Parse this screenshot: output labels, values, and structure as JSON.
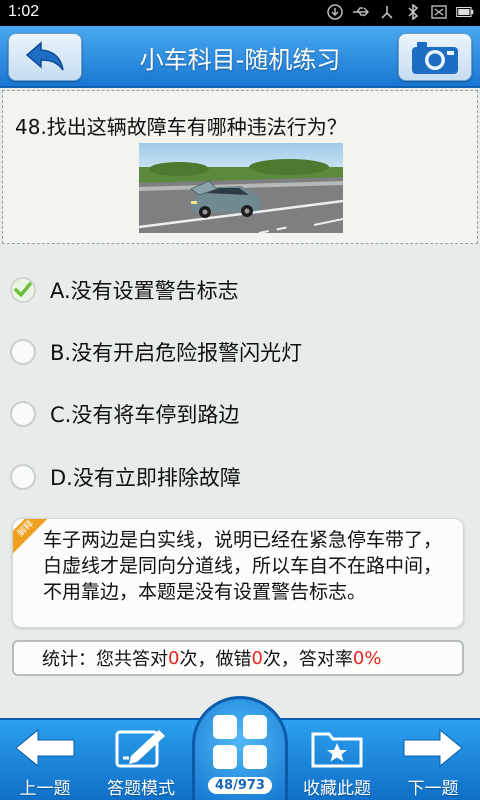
{
  "status_bar": {
    "time": "1:02",
    "icons": [
      "download-icon",
      "usb-icon",
      "transfer-icon",
      "bluetooth-icon",
      "no-sim-icon",
      "battery-icon"
    ]
  },
  "header": {
    "title": "小车科目-随机练习",
    "left_button": "back-icon",
    "right_button": "camera-icon"
  },
  "question": {
    "text": "48.找出这辆故障车有哪种违法行为？",
    "image": "broken-down-car-photo"
  },
  "options": [
    {
      "label": "A.没有设置警告标志",
      "selected": true
    },
    {
      "label": "B.没有开启危险报警闪光灯",
      "selected": false
    },
    {
      "label": "C.没有将车停到路边",
      "selected": false
    },
    {
      "label": "D.没有立即排除故障",
      "selected": false
    }
  ],
  "explanation": {
    "ribbon": "解释",
    "text": "车子两边是白实线，说明已经在紧急停车带了，白虚线才是同向分道线，所以车自不在路中间，不用靠边，本题是没有设置警告标志。"
  },
  "stats": {
    "prefix": "统计：您共答对",
    "correct": "0",
    "mid1": "次，做错",
    "wrong": "0",
    "mid2": "次，答对率",
    "rate": "0%"
  },
  "bottom_nav": {
    "prev": "上一题",
    "mode": "答题模式",
    "progress": "48/973",
    "favorite": "收藏此题",
    "next": "下一题"
  },
  "colors": {
    "header_blue": "#1a77d2",
    "nav_blue": "#106fc7",
    "check_green": "#6cbf3a",
    "stat_red": "#e8261f"
  }
}
